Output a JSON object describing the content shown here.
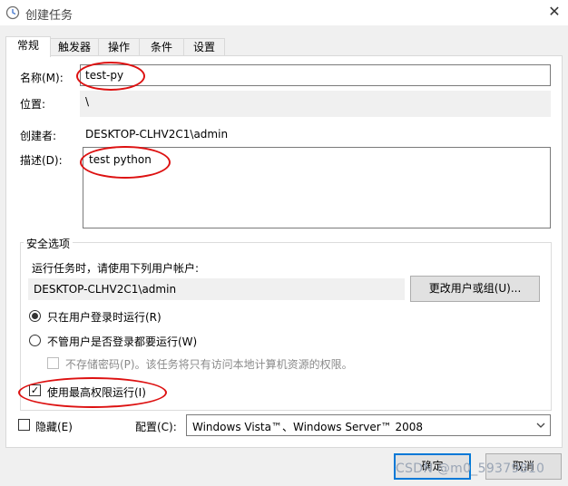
{
  "window": {
    "title": "创建任务",
    "close_glyph": "✕"
  },
  "tabs": [
    {
      "label": "常规"
    },
    {
      "label": "触发器"
    },
    {
      "label": "操作"
    },
    {
      "label": "条件"
    },
    {
      "label": "设置"
    }
  ],
  "general": {
    "name_label": "名称(M):",
    "name_value": "test-py",
    "location_label": "位置:",
    "location_value": "\\",
    "author_label": "创建者:",
    "author_value": "DESKTOP-CLHV2C1\\admin",
    "description_label": "描述(D):",
    "description_value": "test python"
  },
  "security": {
    "group_title": "安全选项",
    "account_prompt": "运行任务时，请使用下列用户帐户:",
    "account_value": "DESKTOP-CLHV2C1\\admin",
    "change_user_button": "更改用户或组(U)...",
    "radio_logged_on": "只在用户登录时运行(R)",
    "radio_logged_on_selected": true,
    "radio_whether": "不管用户是否登录都要运行(W)",
    "radio_whether_selected": false,
    "no_store_password": "不存储密码(P)。该任务将只有访问本地计算机资源的权限。",
    "highest_privileges": "使用最高权限运行(I)",
    "highest_privileges_checked": true
  },
  "footer": {
    "hidden_label": "隐藏(E)",
    "hidden_checked": false,
    "configure_label": "配置(C):",
    "configure_value": "Windows Vista™、Windows Server™ 2008",
    "ok_button": "确定",
    "cancel_button": "取消"
  },
  "watermark": "CSDN @m0_59379810",
  "icons": {
    "title": "clock-icon",
    "close": "close-icon",
    "select": "chevron-down-icon",
    "check": "check-icon"
  },
  "colors": {
    "annotation": "#dd1111",
    "focus": "#0078d7"
  }
}
